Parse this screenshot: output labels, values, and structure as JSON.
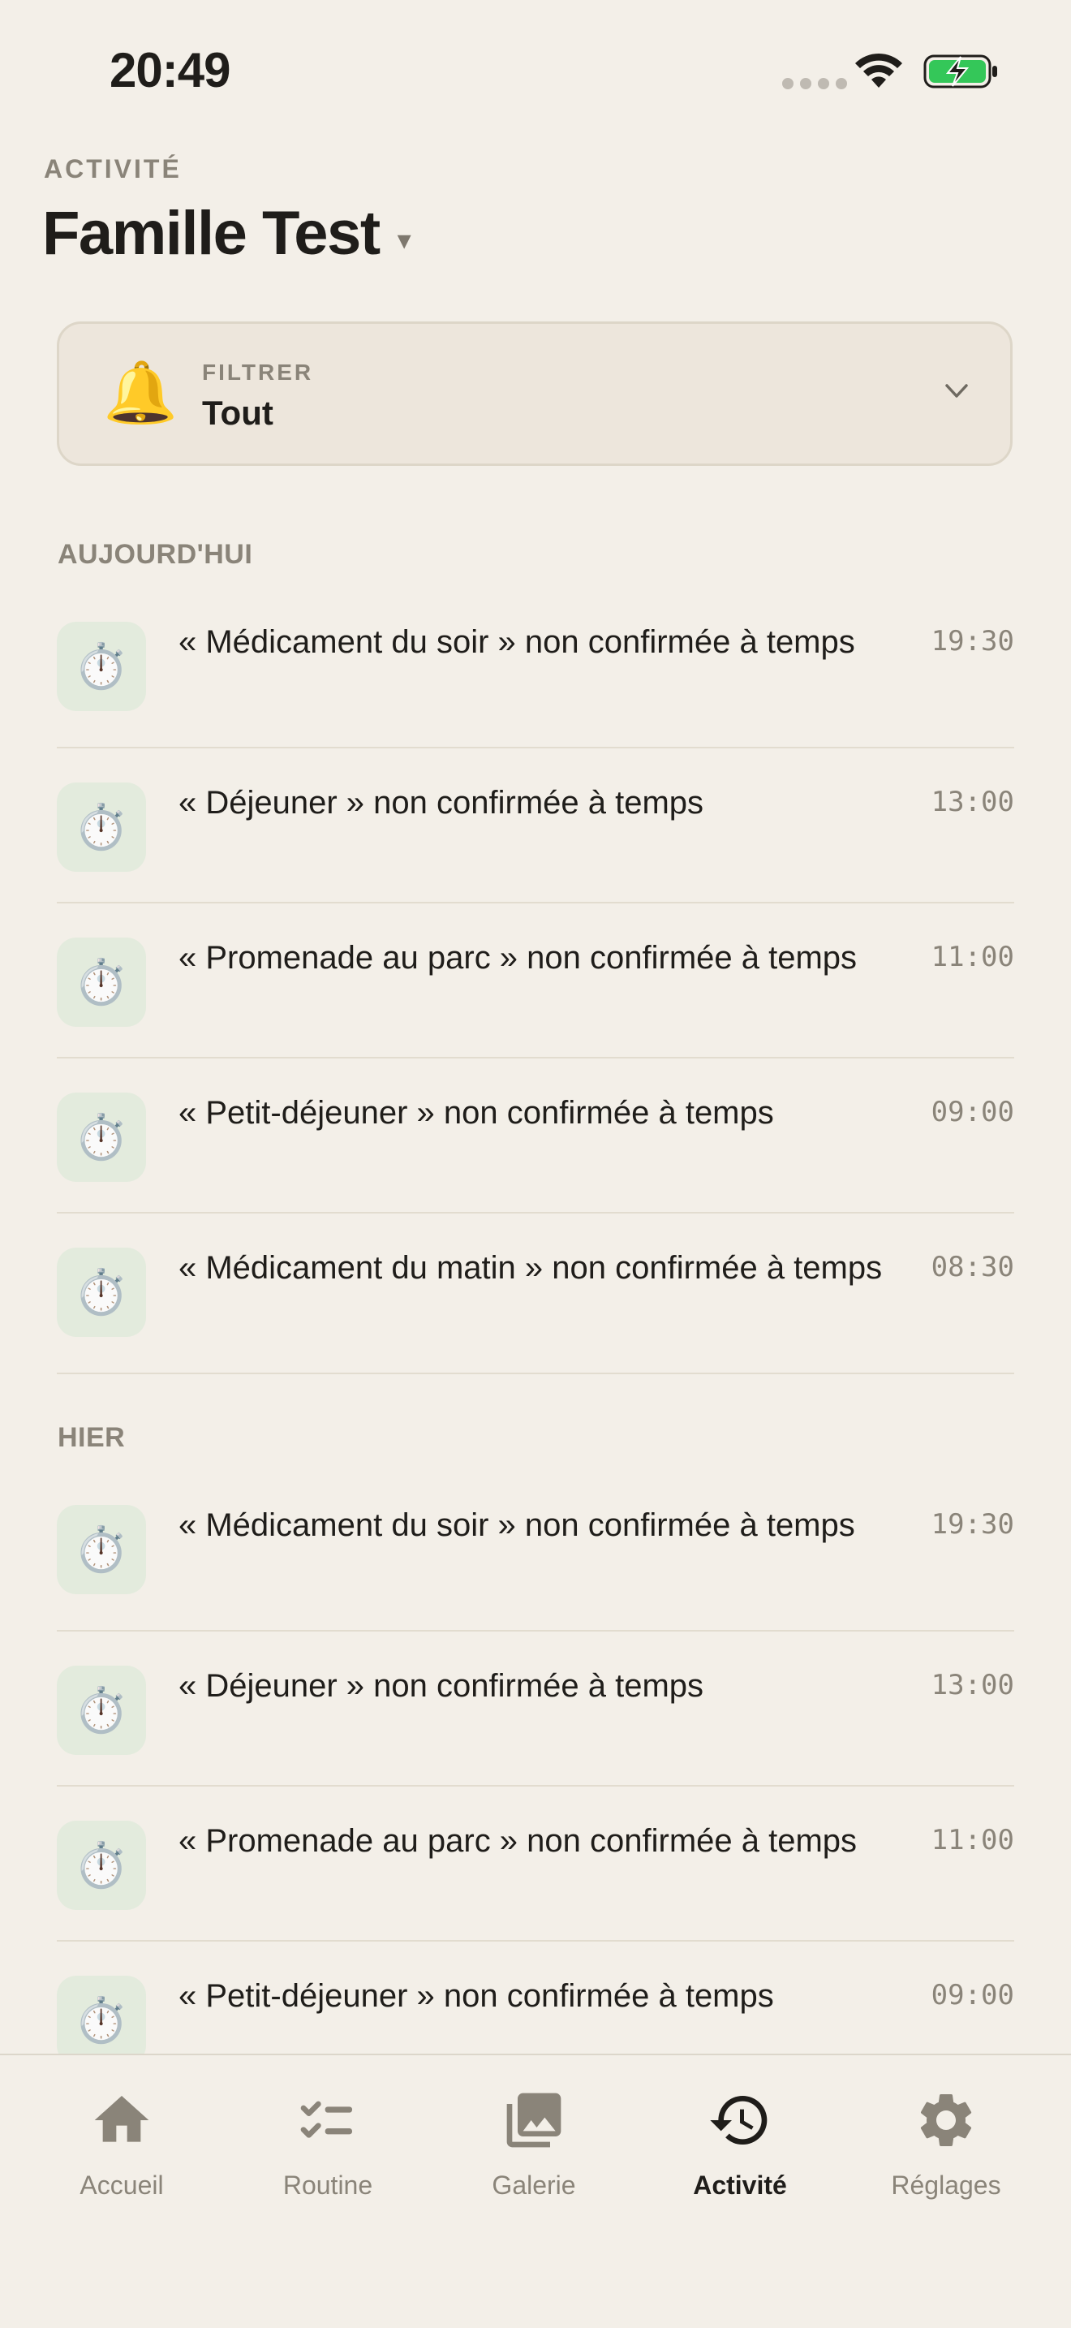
{
  "status_bar": {
    "time": "20:49"
  },
  "header": {
    "eyebrow": "ACTIVITÉ",
    "title": "Famille Test",
    "caret": "▾"
  },
  "filter": {
    "label": "FILTRER",
    "value": "Tout",
    "icon": "bell-icon"
  },
  "sections": {
    "today": {
      "title": "AUJOURD'HUI",
      "items": [
        {
          "text": "« Médicament du soir » non confirmée à temps",
          "time": "19:30"
        },
        {
          "text": "« Déjeuner » non confirmée à temps",
          "time": "13:00"
        },
        {
          "text": "« Promenade au parc » non confirmée à temps",
          "time": "11:00"
        },
        {
          "text": "« Petit-déjeuner » non confirmée à temps",
          "time": "09:00"
        },
        {
          "text": "« Médicament du matin » non confirmée à temps",
          "time": "08:30"
        }
      ]
    },
    "yesterday": {
      "title": "HIER",
      "items": [
        {
          "text": "« Médicament du soir » non confirmée à temps",
          "time": "19:30"
        },
        {
          "text": "« Déjeuner » non confirmée à temps",
          "time": "13:00"
        },
        {
          "text": "« Promenade au parc » non confirmée à temps",
          "time": "11:00"
        },
        {
          "text": "« Petit-déjeuner » non confirmée à temps",
          "time": "09:00"
        }
      ]
    }
  },
  "row_icon": "stopwatch-icon",
  "tab_bar": {
    "tabs": [
      {
        "label": "Accueil",
        "icon": "home-icon",
        "active": false
      },
      {
        "label": "Routine",
        "icon": "checklist-icon",
        "active": false
      },
      {
        "label": "Galerie",
        "icon": "gallery-icon",
        "active": false
      },
      {
        "label": "Activité",
        "icon": "history-icon",
        "active": true
      },
      {
        "label": "Réglages",
        "icon": "gear-icon",
        "active": false
      }
    ]
  },
  "colors": {
    "background": "#f3efe8",
    "icon_tile": "#e3ebdd",
    "muted_text": "#8a8479",
    "battery_green": "#34c759"
  }
}
